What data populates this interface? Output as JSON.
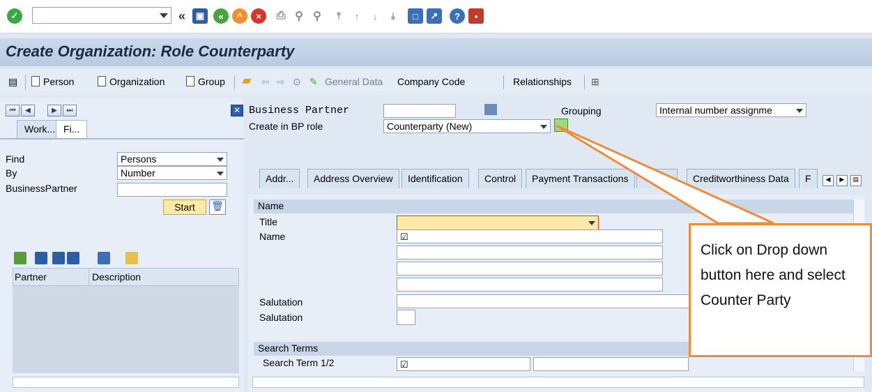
{
  "toolbar": {
    "command_field_value": "",
    "icons": [
      "check-icon",
      "back-nav-icon",
      "save-icon",
      "back-icon",
      "exit-icon",
      "cancel-icon",
      "print-icon",
      "find-icon",
      "find-next-icon",
      "first-page-icon",
      "prev-page-icon",
      "next-page-icon",
      "last-page-icon",
      "new-session-icon",
      "shortcut-icon",
      "help-icon",
      "layout-icon"
    ]
  },
  "title": "Create Organization: Role Counterparty",
  "app_toolbar": {
    "person": "Person",
    "organization": "Organization",
    "group": "Group",
    "general_data": "General Data",
    "company_code": "Company Code",
    "relationships": "Relationships"
  },
  "left": {
    "tabs": [
      "Work...",
      "Fi..."
    ],
    "find_label": "Find",
    "find_value": "Persons",
    "by_label": "By",
    "by_value": "Number",
    "bp_label": "BusinessPartner",
    "start": "Start",
    "grid_cols": [
      "Partner",
      "Description"
    ]
  },
  "header": {
    "bp_label": "Business Partner",
    "grouping_label": "Grouping",
    "grouping_value": "Internal number assignme",
    "role_label": "Create in BP role",
    "role_value": "Counterparty (New)"
  },
  "tabs": [
    "Addr...",
    "Address Overview",
    "Identification",
    "Control",
    "Payment Transactions",
    "tus",
    "Creditworthiness Data",
    "F"
  ],
  "form": {
    "name_section": "Name",
    "title_label": "Title",
    "name_label": "Name",
    "salutation1": "Salutation",
    "salutation2": "Salutation",
    "search_section": "Search Terms",
    "search_term_label": "Search Term 1/2"
  },
  "callout": "Click on Drop down button here and select Counter Party",
  "colors": {
    "accent": "#ef8c3c",
    "title_bg": "#c3d4e8",
    "required_field": "#ffe9a8"
  }
}
